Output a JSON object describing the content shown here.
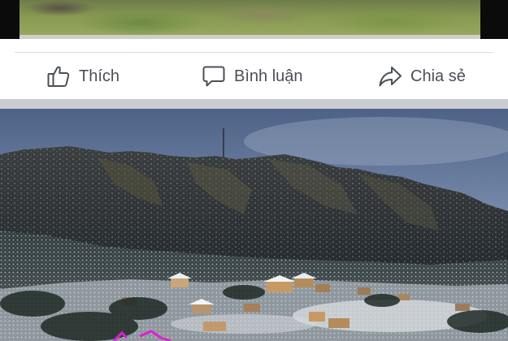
{
  "feed": {
    "actions": {
      "like_label": "Thích",
      "comment_label": "Bình luận",
      "share_label": "Chia sẻ"
    },
    "icons": {
      "like": "thumbs-up-icon",
      "comment": "comment-bubble-icon",
      "share": "share-arrow-icon"
    }
  },
  "colors": {
    "action_text": "#4b4f56",
    "separator": "#c9ccd1"
  }
}
